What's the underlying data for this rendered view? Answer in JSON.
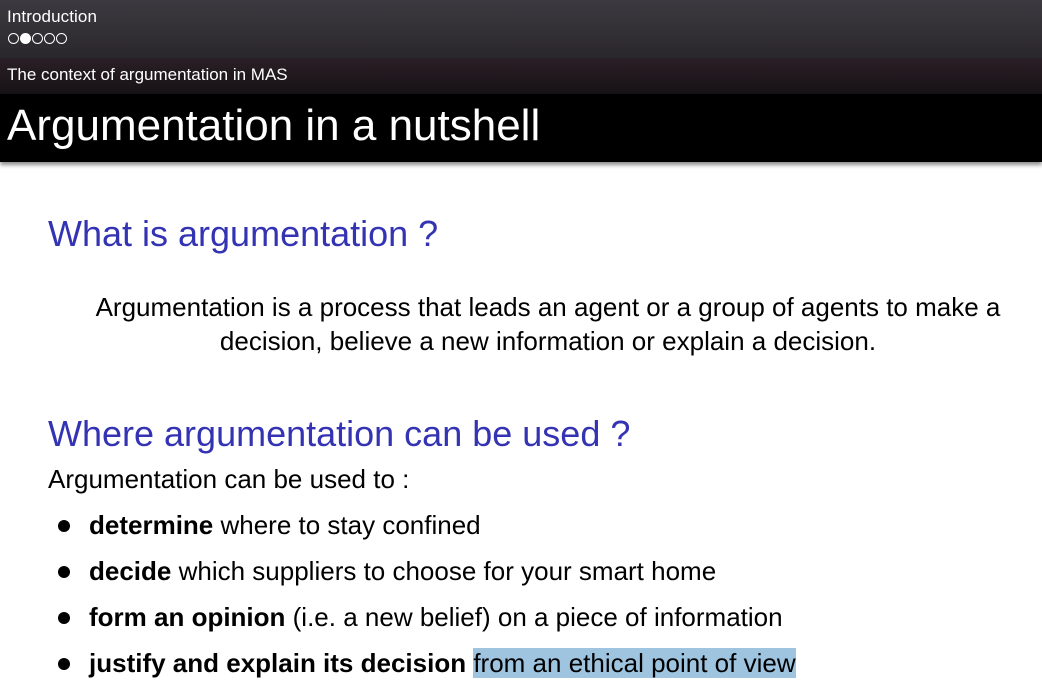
{
  "header": {
    "section": "Introduction",
    "nav_dots": [
      {
        "state": "empty"
      },
      {
        "state": "filled"
      },
      {
        "state": "empty"
      },
      {
        "state": "empty"
      },
      {
        "state": "empty"
      }
    ],
    "subsection": "The context of argumentation in MAS",
    "frame_title": "Argumentation in a nutshell"
  },
  "content": {
    "block1_title": "What is argumentation ?",
    "definition": "Argumentation is a process that leads an agent or a group of agents to make a decision, believe a new information or explain a decision.",
    "block2_title": "Where argumentation can be used ?",
    "intro": "Argumentation can be used to :",
    "bullets": [
      {
        "bold": "determine",
        "rest": " where to stay confined",
        "highlight": ""
      },
      {
        "bold": "decide",
        "rest": " which suppliers to choose for your smart home",
        "highlight": ""
      },
      {
        "bold": "form an opinion",
        "rest": " (i.e. a new belief) on a piece of information",
        "highlight": ""
      },
      {
        "bold": "justify and explain its decision",
        "rest": " ",
        "highlight": "from an ethical point of view"
      }
    ]
  },
  "colors": {
    "block_title": "#3333b3",
    "highlight": "#9ec4e0",
    "header_bg": "#2a272c",
    "frame_title_bg": "#000000"
  }
}
